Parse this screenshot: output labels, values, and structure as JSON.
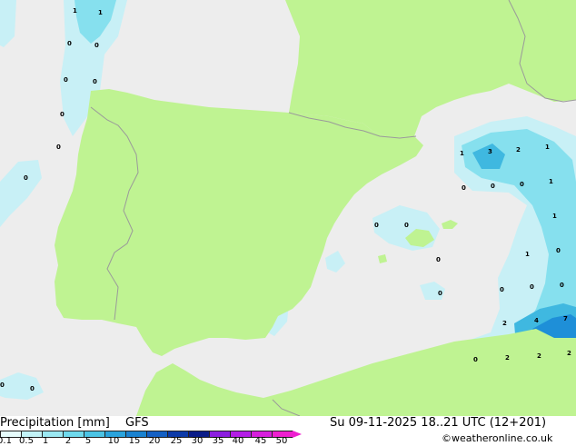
{
  "footer": {
    "title": "Precipitation [mm]",
    "model": "GFS",
    "datetime": "Su 09-11-2025 18..21 UTC (12+201)",
    "credit": "©weatheronline.co.uk"
  },
  "colors": {
    "sea": "#ededed",
    "land": "#bff392",
    "border": "#9a9a9a",
    "precip_light": "#c8f0f6",
    "precip_medium": "#86e0ee",
    "precip_strong": "#3fb8e0",
    "precip_heavy": "#1e8fd8"
  },
  "scale": {
    "ticks": [
      "0.1",
      "0.5",
      "1",
      "2",
      "5",
      "10",
      "15",
      "20",
      "25",
      "30",
      "35",
      "40",
      "45",
      "50"
    ],
    "colors": [
      "#e6fbfb",
      "#c2f2f6",
      "#9be8f2",
      "#6fd9ec",
      "#4cc3e4",
      "#2aa3dc",
      "#1a82d0",
      "#1460c4",
      "#0c3aa8",
      "#0a1c88",
      "#8c1ee0",
      "#b41ee6",
      "#d61edc",
      "#ee1ed0"
    ]
  },
  "precip_labels": [
    "1",
    "1",
    "0",
    "0",
    "0",
    "0",
    "0",
    "0",
    "0",
    "1",
    "3",
    "2",
    "1",
    "1",
    "0",
    "0",
    "0",
    "1",
    "0",
    "0",
    "0",
    "0",
    "0",
    "1",
    "0",
    "0",
    "0",
    "2",
    "4",
    "7",
    "2",
    "2",
    "2",
    "0",
    "0",
    "0"
  ]
}
